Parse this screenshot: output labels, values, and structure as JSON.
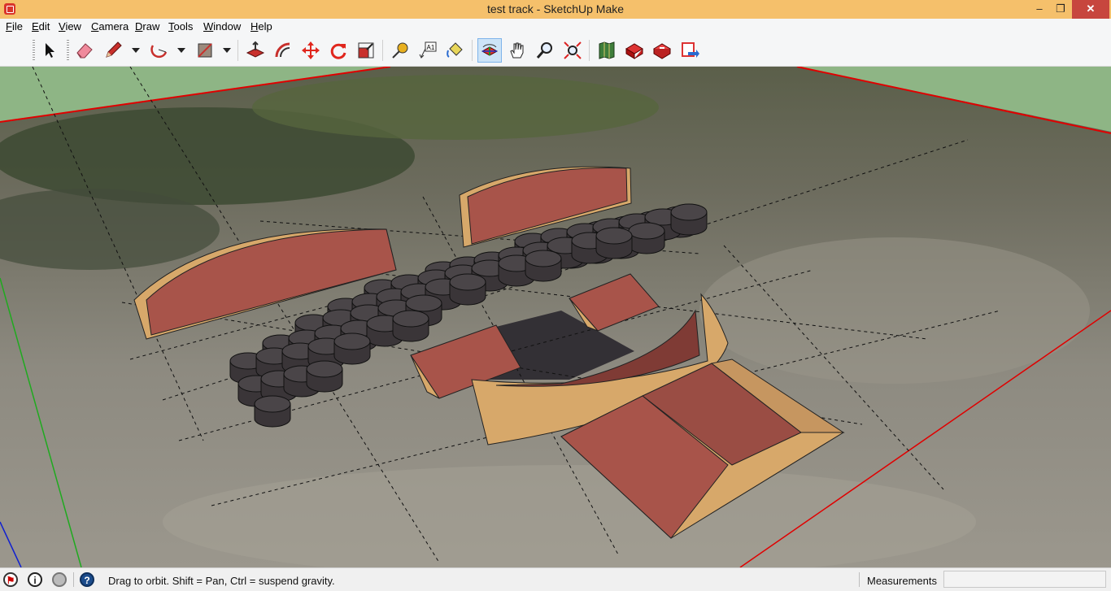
{
  "window": {
    "title": "test track - SketchUp Make",
    "minimize": "–",
    "maximize": "❐",
    "close": "✕"
  },
  "menu": {
    "items": [
      "File",
      "Edit",
      "View",
      "Camera",
      "Draw",
      "Tools",
      "Window",
      "Help"
    ]
  },
  "toolbar": {
    "tools": [
      {
        "name": "select",
        "icon": "arrow-cursor-icon"
      },
      {
        "name": "eraser",
        "icon": "eraser-icon"
      },
      {
        "name": "pencil",
        "icon": "pencil-icon"
      },
      {
        "name": "arc",
        "icon": "arc-icon"
      },
      {
        "name": "rectangle",
        "icon": "rectangle-icon"
      },
      {
        "name": "push-pull",
        "icon": "push-pull-icon"
      },
      {
        "name": "offset",
        "icon": "offset-icon"
      },
      {
        "name": "move",
        "icon": "move-icon"
      },
      {
        "name": "rotate",
        "icon": "rotate-icon"
      },
      {
        "name": "scale",
        "icon": "scale-icon"
      },
      {
        "name": "tape-measure",
        "icon": "tape-measure-icon"
      },
      {
        "name": "text",
        "icon": "text-icon"
      },
      {
        "name": "paint-bucket",
        "icon": "paint-bucket-icon"
      },
      {
        "name": "orbit",
        "icon": "orbit-icon",
        "active": true
      },
      {
        "name": "pan",
        "icon": "hand-icon"
      },
      {
        "name": "zoom",
        "icon": "magnifier-icon"
      },
      {
        "name": "zoom-extents",
        "icon": "zoom-extents-icon"
      },
      {
        "name": "add-location",
        "icon": "map-icon"
      },
      {
        "name": "3d-warehouse",
        "icon": "warehouse-icon"
      },
      {
        "name": "share-model",
        "icon": "share-icon"
      },
      {
        "name": "extension-warehouse",
        "icon": "extension-icon"
      }
    ],
    "text_tool_glyph": "A1"
  },
  "status": {
    "message": "Drag to orbit. Shift = Pan, Ctrl = suspend gravity.",
    "measurements_label": "Measurements",
    "measurements_value": "",
    "info_glyph": "i",
    "help_glyph": "?"
  },
  "colors": {
    "title_bar": "#f5c06b",
    "sky": "#8eb585",
    "ramp_face": "#a8544a",
    "ramp_side": "#d7a86a",
    "tire": "#3a3538",
    "axis_red": "#e00000",
    "axis_green": "#1faa1f",
    "axis_blue": "#1020d0"
  }
}
